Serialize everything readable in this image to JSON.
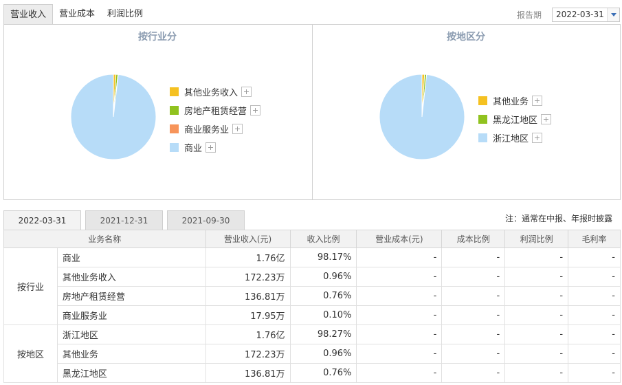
{
  "top_tabs": [
    {
      "label": "营业收入",
      "active": true
    },
    {
      "label": "营业成本",
      "active": false
    },
    {
      "label": "利润比例",
      "active": false
    }
  ],
  "period": {
    "label": "报告期",
    "value": "2022-03-31"
  },
  "charts": {
    "industry": {
      "title": "按行业分",
      "legend": [
        {
          "label": "其他业务收入",
          "color": "#f5c121"
        },
        {
          "label": "房地产租赁经营",
          "color": "#90c21f"
        },
        {
          "label": "商业服务业",
          "color": "#f7945a"
        },
        {
          "label": "商业",
          "color": "#b7dcf8"
        }
      ]
    },
    "region": {
      "title": "按地区分",
      "legend": [
        {
          "label": "其他业务",
          "color": "#f5c121"
        },
        {
          "label": "黑龙江地区",
          "color": "#90c21f"
        },
        {
          "label": "浙江地区",
          "color": "#b7dcf8"
        }
      ]
    }
  },
  "chart_data": [
    {
      "type": "pie",
      "title": "按行业分",
      "categories": [
        "其他业务收入",
        "房地产租赁经营",
        "商业服务业",
        "商业"
      ],
      "values": [
        0.96,
        0.76,
        0.1,
        98.17
      ],
      "colors": [
        "#f5c121",
        "#90c21f",
        "#f7945a",
        "#b7dcf8"
      ],
      "legend": "right"
    },
    {
      "type": "pie",
      "title": "按地区分",
      "categories": [
        "其他业务",
        "黑龙江地区",
        "浙江地区"
      ],
      "values": [
        0.96,
        0.76,
        98.27
      ],
      "colors": [
        "#f5c121",
        "#90c21f",
        "#b7dcf8"
      ],
      "legend": "right"
    }
  ],
  "date_tabs": [
    {
      "label": "2022-03-31",
      "active": true
    },
    {
      "label": "2021-12-31",
      "active": false
    },
    {
      "label": "2021-09-30",
      "active": false
    }
  ],
  "note": "注：通常在中报、年报时披露",
  "table": {
    "headers": [
      "业务名称",
      "营业收入(元)",
      "收入比例",
      "营业成本(元)",
      "成本比例",
      "利润比例",
      "毛利率"
    ],
    "groups": [
      {
        "label": "按行业",
        "rows": [
          [
            "商业",
            "1.76亿",
            "98.17%",
            "-",
            "-",
            "-",
            "-"
          ],
          [
            "其他业务收入",
            "172.23万",
            "0.96%",
            "-",
            "-",
            "-",
            "-"
          ],
          [
            "房地产租赁经营",
            "136.81万",
            "0.76%",
            "-",
            "-",
            "-",
            "-"
          ],
          [
            "商业服务业",
            "17.95万",
            "0.10%",
            "-",
            "-",
            "-",
            "-"
          ]
        ]
      },
      {
        "label": "按地区",
        "rows": [
          [
            "浙江地区",
            "1.76亿",
            "98.27%",
            "-",
            "-",
            "-",
            "-"
          ],
          [
            "其他业务",
            "172.23万",
            "0.96%",
            "-",
            "-",
            "-",
            "-"
          ],
          [
            "黑龙江地区",
            "136.81万",
            "0.76%",
            "-",
            "-",
            "-",
            "-"
          ]
        ]
      }
    ]
  }
}
